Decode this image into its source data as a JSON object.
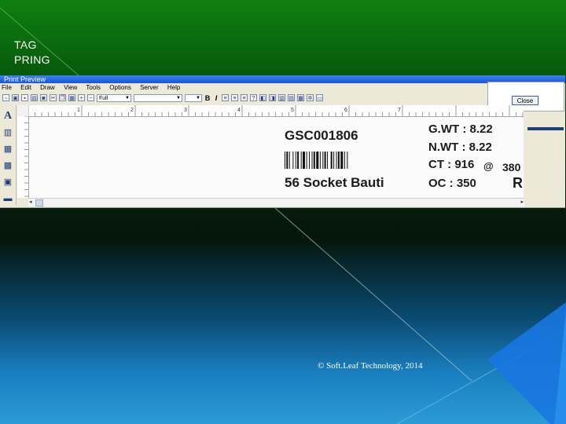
{
  "slide": {
    "title_line1": "TAG",
    "title_line2": "PRING",
    "footer": "© Soft.Leaf Technology, 2014"
  },
  "window": {
    "title": "Print Preview",
    "menu": [
      "File",
      "Edit",
      "Draw",
      "View",
      "Tools",
      "Options",
      "Server",
      "Help"
    ],
    "zoom_select": "Full",
    "bold_label": "B",
    "italic_label": "I",
    "close_label": "Close"
  },
  "ruler": {
    "ticks": [
      "1",
      "2",
      "3",
      "4",
      "5",
      "6",
      "7"
    ]
  },
  "label": {
    "code": "GSC001806",
    "description": "56 Socket Bauti",
    "gross_weight": "G.WT : 8.22",
    "net_weight": "N.WT : 8.22",
    "ct": "CT : 916",
    "at_symbol": "@",
    "rate": "380",
    "oc": "OC : 350",
    "trailing": "R"
  },
  "colors": {
    "green_top": "#0f7f10",
    "blue_bottom": "#2b9bd6",
    "title_bar": "#1a56d6"
  }
}
